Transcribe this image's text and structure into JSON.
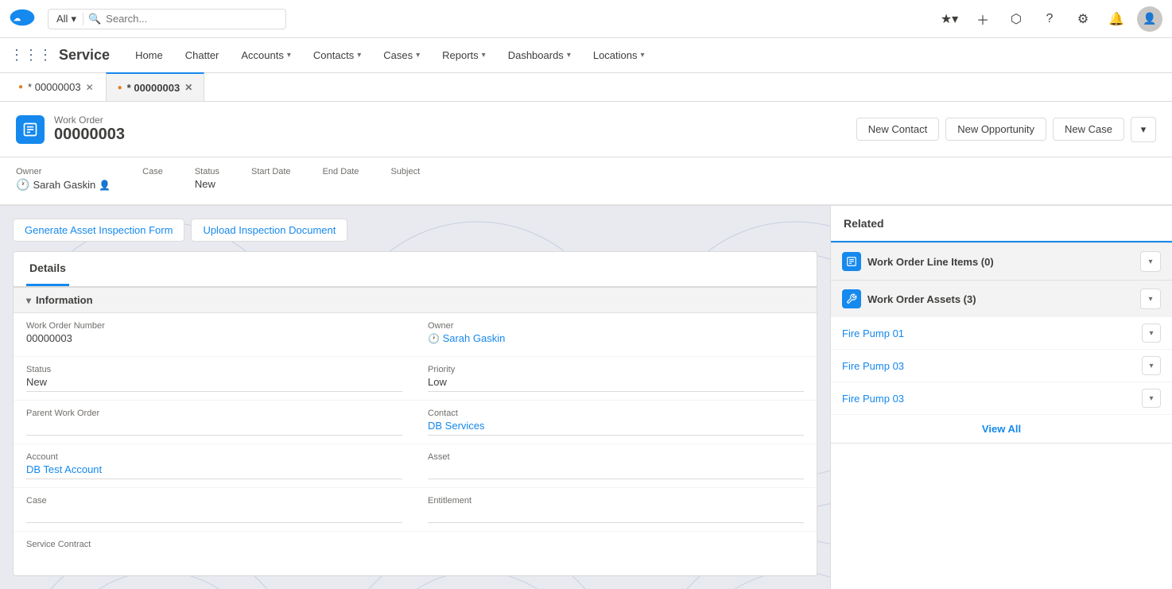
{
  "app": {
    "name": "Service",
    "logo_color": "#1589ee"
  },
  "search": {
    "placeholder": "Search...",
    "type": "All"
  },
  "nav": {
    "items": [
      {
        "label": "Home",
        "has_dropdown": false
      },
      {
        "label": "Chatter",
        "has_dropdown": false
      },
      {
        "label": "Accounts",
        "has_dropdown": true
      },
      {
        "label": "Contacts",
        "has_dropdown": true
      },
      {
        "label": "Cases",
        "has_dropdown": true
      },
      {
        "label": "Reports",
        "has_dropdown": true
      },
      {
        "label": "Dashboards",
        "has_dropdown": true
      },
      {
        "label": "Locations",
        "has_dropdown": true
      }
    ]
  },
  "tabs": [
    {
      "label": "* 00000003",
      "active": false,
      "has_close": true,
      "modified": true
    },
    {
      "label": "* 00000003",
      "active": true,
      "has_close": true,
      "modified": true
    }
  ],
  "work_order": {
    "type": "Work Order",
    "number": "00000003",
    "buttons": {
      "new_contact": "New Contact",
      "new_opportunity": "New Opportunity",
      "new_case": "New Case"
    },
    "fields": {
      "owner_label": "Owner",
      "owner_value": "Sarah Gaskin",
      "case_label": "Case",
      "case_value": "",
      "status_label": "Status",
      "status_value": "New",
      "start_date_label": "Start Date",
      "start_date_value": "",
      "end_date_label": "End Date",
      "end_date_value": "",
      "subject_label": "Subject",
      "subject_value": ""
    }
  },
  "actions": {
    "generate_form": "Generate Asset Inspection Form",
    "upload_doc": "Upload Inspection Document"
  },
  "details": {
    "tab_label": "Details",
    "section_label": "Information",
    "fields_left": [
      {
        "label": "Work Order Number",
        "value": "00000003",
        "type": "text"
      },
      {
        "label": "Status",
        "value": "New",
        "type": "editable"
      },
      {
        "label": "Parent Work Order",
        "value": "",
        "type": "editable"
      },
      {
        "label": "Account",
        "value": "DB Test Account",
        "type": "link"
      },
      {
        "label": "Case",
        "value": "",
        "type": "editable"
      },
      {
        "label": "Service Contract",
        "value": "",
        "type": "text"
      }
    ],
    "fields_right": [
      {
        "label": "Owner",
        "value": "Sarah Gaskin",
        "type": "link"
      },
      {
        "label": "Priority",
        "value": "Low",
        "type": "editable"
      },
      {
        "label": "Contact",
        "value": "DB Services",
        "type": "link"
      },
      {
        "label": "Asset",
        "value": "",
        "type": "editable"
      },
      {
        "label": "Entitlement",
        "value": "",
        "type": "editable"
      }
    ]
  },
  "related": {
    "tab_label": "Related",
    "sections": [
      {
        "label": "Work Order Line Items (0)",
        "icon": "checklist",
        "items": [],
        "show_view_all": false
      },
      {
        "label": "Work Order Assets (3)",
        "icon": "wrench",
        "items": [
          {
            "label": "Fire Pump 01"
          },
          {
            "label": "Fire Pump 03"
          },
          {
            "label": "Fire Pump 03"
          }
        ],
        "show_view_all": true,
        "view_all_label": "View All"
      }
    ]
  }
}
